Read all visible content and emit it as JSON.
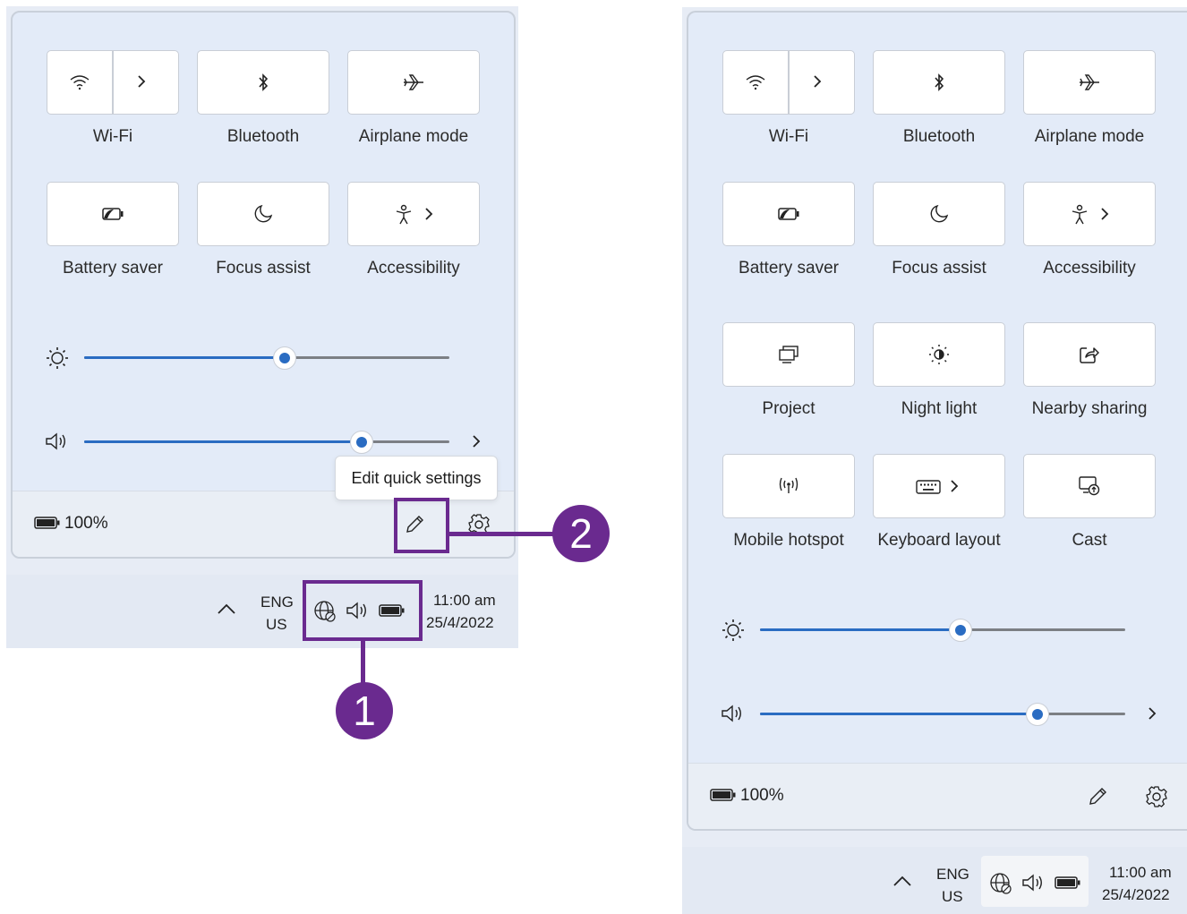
{
  "left": {
    "tiles": [
      {
        "label": "Wi-Fi",
        "icon": "wifi-icon",
        "has_arrow": true
      },
      {
        "label": "Bluetooth",
        "icon": "bluetooth-icon"
      },
      {
        "label": "Airplane mode",
        "icon": "airplane-icon"
      },
      {
        "label": "Battery saver",
        "icon": "battery-saver-icon"
      },
      {
        "label": "Focus assist",
        "icon": "moon-icon"
      },
      {
        "label": "Accessibility",
        "icon": "accessibility-icon",
        "has_arrow": true
      }
    ],
    "brightness_level": 0.55,
    "volume_level": 0.76,
    "tooltip": "Edit quick settings",
    "battery": "100%",
    "callout_1": "1",
    "callout_2": "2"
  },
  "right": {
    "tiles": [
      {
        "label": "Wi-Fi",
        "icon": "wifi-icon",
        "has_arrow": true
      },
      {
        "label": "Bluetooth",
        "icon": "bluetooth-icon"
      },
      {
        "label": "Airplane mode",
        "icon": "airplane-icon"
      },
      {
        "label": "Battery saver",
        "icon": "battery-saver-icon"
      },
      {
        "label": "Focus assist",
        "icon": "moon-icon"
      },
      {
        "label": "Accessibility",
        "icon": "accessibility-icon",
        "has_arrow": true
      },
      {
        "label": "Project",
        "icon": "project-icon"
      },
      {
        "label": "Night light",
        "icon": "night-light-icon"
      },
      {
        "label": "Nearby sharing",
        "icon": "share-icon"
      },
      {
        "label": "Mobile hotspot",
        "icon": "hotspot-icon"
      },
      {
        "label": "Keyboard layout",
        "icon": "keyboard-icon",
        "has_arrow": true
      },
      {
        "label": "Cast",
        "icon": "cast-icon"
      }
    ],
    "brightness_level": 0.55,
    "volume_level": 0.76,
    "battery": "100%"
  },
  "taskbar": {
    "lang_top": "ENG",
    "lang_bottom": "US",
    "time": "11:00 am",
    "date": "25/4/2022"
  },
  "colors": {
    "accent": "#2a6cc2",
    "callout": "#6a2a8f",
    "panel_bg": "#e3ebf8"
  }
}
